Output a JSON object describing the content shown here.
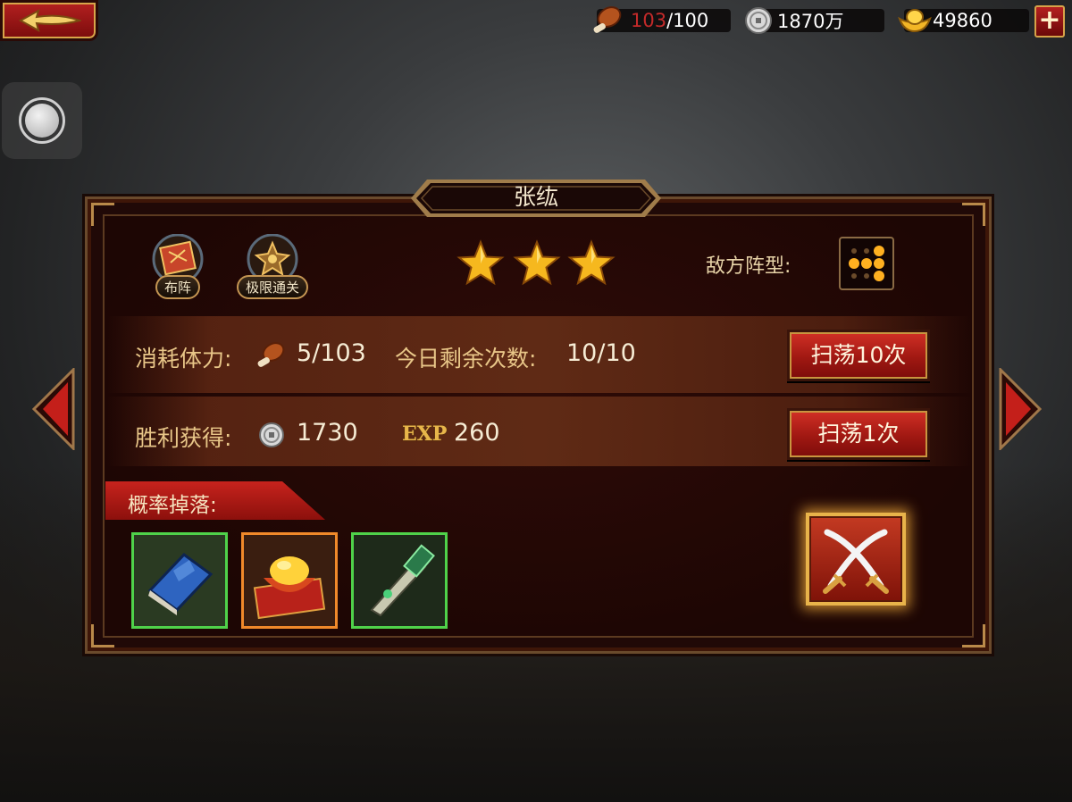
{
  "topbar": {
    "stamina": {
      "current": "103",
      "max": "/100",
      "icon": "meat-icon"
    },
    "silver": {
      "value": "1870万",
      "icon": "silver-coin-icon"
    },
    "gold": {
      "value": "49860",
      "icon": "gold-ingot-icon"
    },
    "plus_label": "+"
  },
  "panel": {
    "title": "张纮",
    "formation_label": "布阵",
    "challenge_label": "极限通关",
    "stars": 3,
    "enemy_formation_label": "敌方阵型:",
    "cost_label": "消耗体力:",
    "cost_value": "5/103",
    "remaining_label": "今日剩余次数:",
    "remaining_value": "10/10",
    "reward_label": "胜利获得:",
    "reward_silver": "1730",
    "exp_tag": "EXP",
    "exp_value": "260",
    "sweep10_label": "扫荡10次",
    "sweep1_label": "扫荡1次",
    "drop_label": "概率掉落:",
    "drops": [
      {
        "name": "blue-book",
        "rarity": "green"
      },
      {
        "name": "golden-bowl",
        "rarity": "orange"
      },
      {
        "name": "jade-dagger",
        "rarity": "green"
      }
    ]
  },
  "colors": {
    "accent_red": "#b42020",
    "gold_trim": "#c9953f",
    "rarity_green": "#4fd24a",
    "rarity_orange": "#f0892a"
  }
}
